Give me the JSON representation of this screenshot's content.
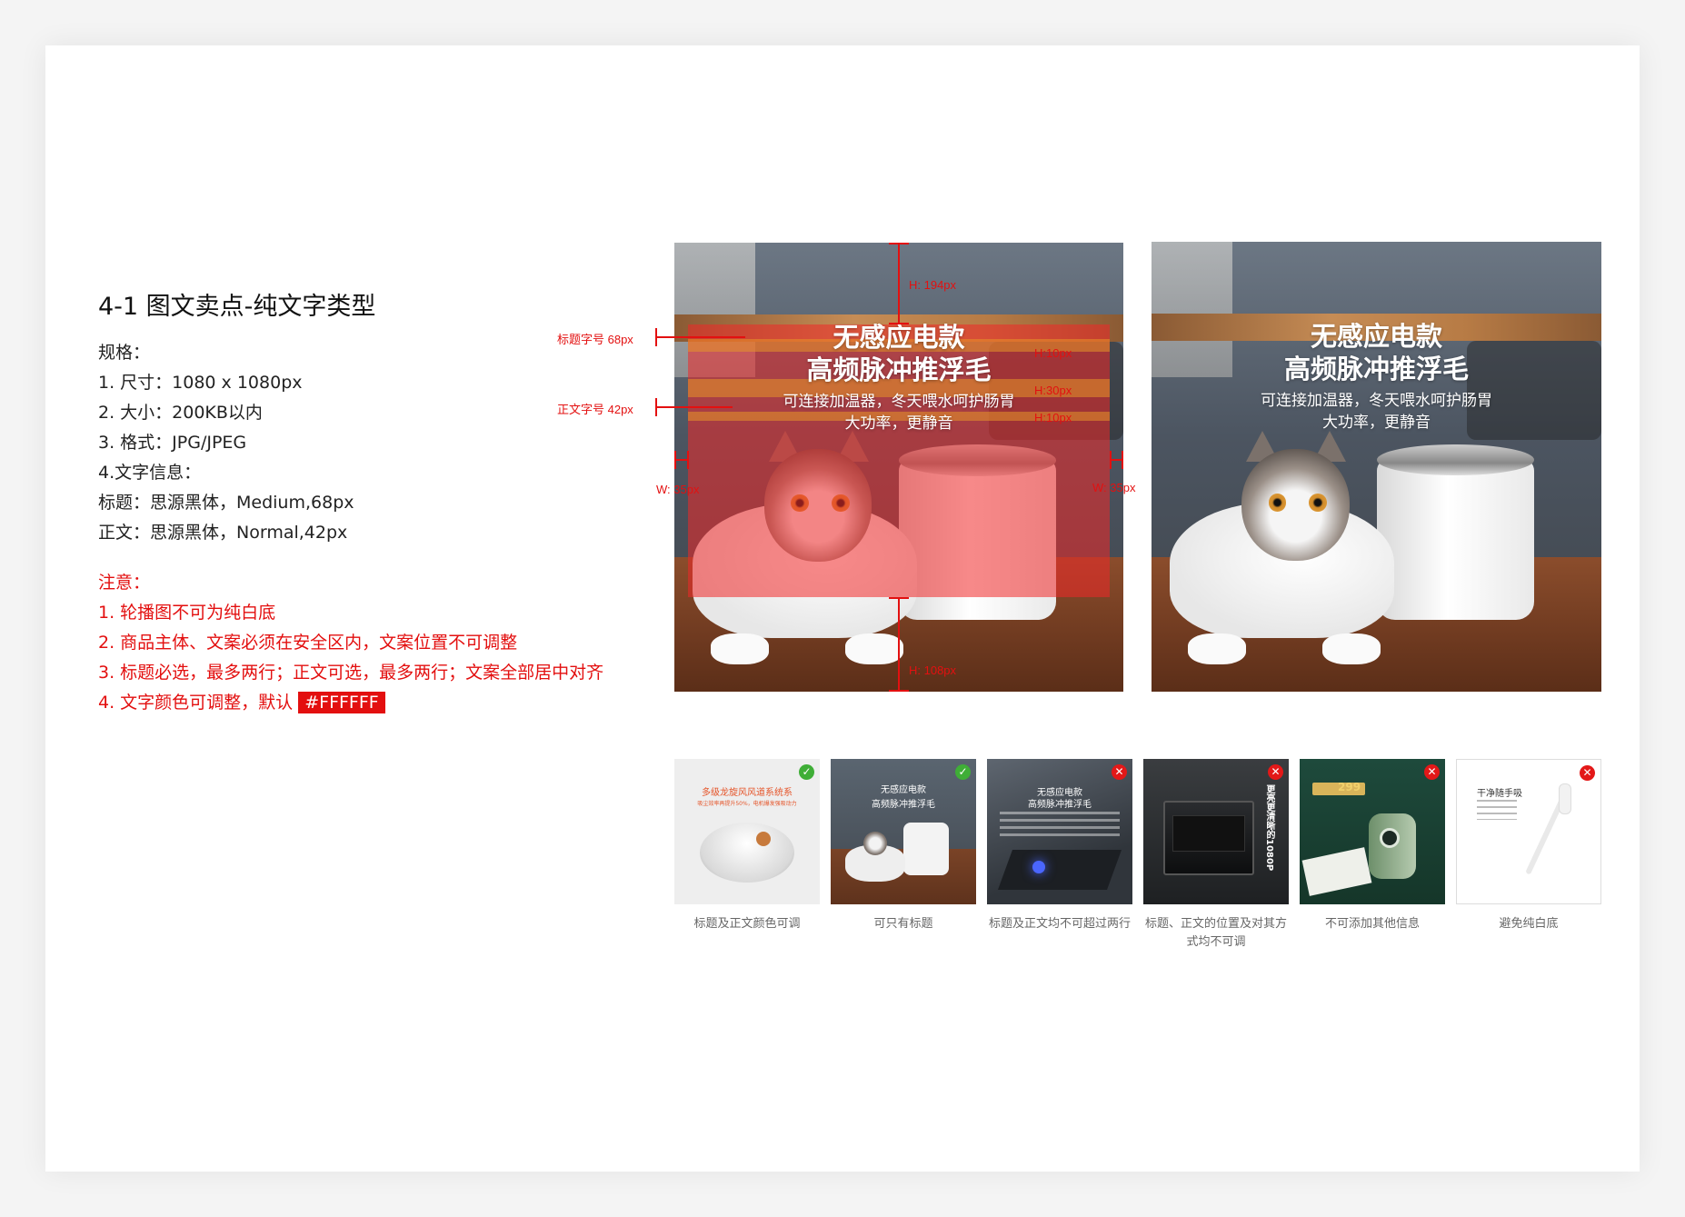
{
  "spec": {
    "title": "4-1 图文卖点-纯文字类型",
    "lines": [
      "规格：",
      "1. 尺寸：1080 x 1080px",
      "2. 大小：200KB以内",
      "3. 格式：JPG/JPEG",
      "4.文字信息：",
      "标题：思源黑体，Medium,68px",
      "正文：思源黑体，Normal,42px"
    ],
    "notes_title": "注意：",
    "notes": [
      "1. 轮播图不可为纯白底",
      "2. 商品主体、文案必须在安全区内，文案位置不可调整",
      "3. 标题必选，最多两行；正文可选，最多两行；文案全部居中对齐"
    ],
    "note4_prefix": "4. 文字颜色可调整，默认 ",
    "note4_hex": "#FFFFFF"
  },
  "banner": {
    "title1": "无感应电款",
    "title2": "高频脉冲推浮毛",
    "body1": "可连接加温器，冬天喂水呵护肠胃",
    "body2": "大功率，更静音"
  },
  "annotations": {
    "title_size": "标题字号 68px",
    "body_size": "正文字号 42px",
    "h_top": "H: 194px",
    "h_bottom": "H: 108px",
    "h10a": "H:10px",
    "h30": "H:30px",
    "h10b": "H:10px",
    "w_left": "W: 35px",
    "w_right": "W: 35px"
  },
  "thumbnails": [
    {
      "caption": "标题及正文颜色可调",
      "status": "ok",
      "t1": "多级龙旋风风道系统系",
      "t2": "吸尘效率再提升50%，电机爆发强吸动力"
    },
    {
      "caption": "可只有标题",
      "status": "ok",
      "t1": "无感应电款",
      "t2": "高频脉冲推浮毛"
    },
    {
      "caption": "标题及正文均不可超过两行",
      "status": "bad",
      "t1": "无感应电款",
      "t2": "高频脉冲推浮毛"
    },
    {
      "caption": "标题、正文的位置及对其方式均不可调",
      "status": "bad",
      "t1": "更亮更清晰的1080P",
      "t2": ""
    },
    {
      "caption": "不可添加其他信息",
      "status": "bad",
      "t1": "299",
      "t2": ""
    },
    {
      "caption": "避免纯白底",
      "status": "bad",
      "t1": "干净随手吸",
      "t2": ""
    }
  ],
  "colors": {
    "accent_red": "#e30f0f",
    "ok_green": "#3fae37"
  }
}
